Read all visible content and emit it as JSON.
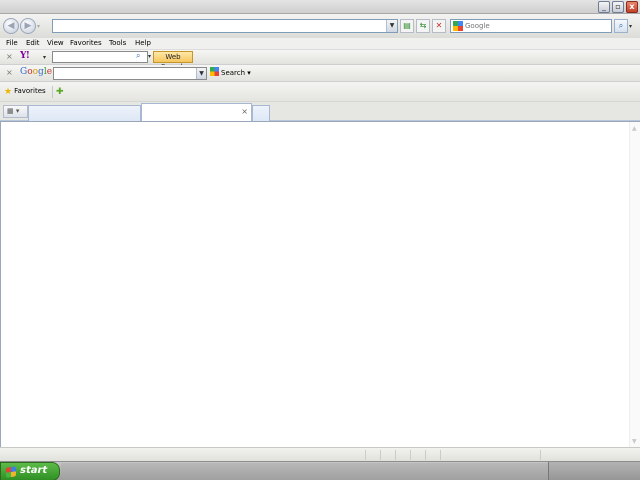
{
  "window": {
    "minimize_glyph": "_",
    "restore_glyph": "▫",
    "close_glyph": "x"
  },
  "address_bar": {
    "value": "",
    "search_placeholder": "Google"
  },
  "menu": {
    "items": [
      "File",
      "Edit",
      "View",
      "Favorites",
      "Tools",
      "Help"
    ]
  },
  "yahoo_toolbar": {
    "logo": "Y!",
    "search_value": "",
    "web_search_label": "Web Search"
  },
  "google_toolbar": {
    "logo": "Google",
    "search_value": "",
    "search_label": "Search"
  },
  "favorites_bar": {
    "favorites_label": "Favorites"
  },
  "tabs": {
    "close_glyph": "×"
  },
  "taskbar": {
    "start_label": "start"
  },
  "colors": {
    "google_blue": "#3366cc",
    "google_red": "#cc3333",
    "google_yellow": "#dd9900",
    "google_green": "#339933",
    "yahoo_purple": "#7b0099",
    "start_green": "#3a9a2c",
    "web_search_orange": "#f6c55f"
  }
}
